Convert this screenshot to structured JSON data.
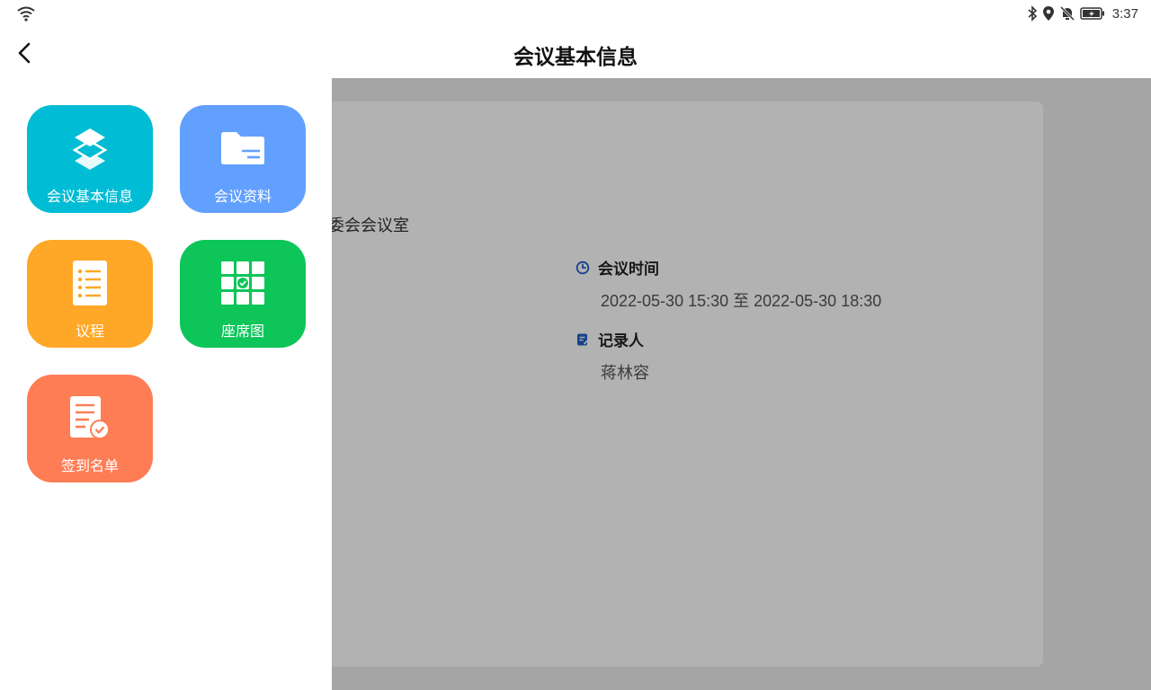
{
  "status_bar": {
    "time": "3:37",
    "icons": [
      "wifi-icon",
      "bluetooth-icon",
      "location-icon",
      "mute-icon",
      "battery-charging-icon"
    ]
  },
  "header": {
    "title": "会议基本信息",
    "back_icon": "chevron-left-icon"
  },
  "detail": {
    "location_partial": "委会会议室",
    "time_label": "会议时间",
    "time_value": "2022-05-30 15:30 至 2022-05-30 18:30",
    "recorder_label": "记录人",
    "recorder_value": "蒋林容"
  },
  "menu": {
    "items": [
      {
        "label": "会议基本信息",
        "icon": "layers-icon",
        "color": "#00BCD4"
      },
      {
        "label": "会议资料",
        "icon": "folder-icon",
        "color": "#62A0FF"
      },
      {
        "label": "议程",
        "icon": "list-document-icon",
        "color": "#FFA726"
      },
      {
        "label": "座席图",
        "icon": "seat-grid-icon",
        "color": "#0DC559"
      },
      {
        "label": "签到名单",
        "icon": "checklist-document-icon",
        "color": "#FF7D55"
      }
    ]
  },
  "colors": {
    "accent_blue": "#1E5FC8",
    "overlay": "rgba(0,0,0,0.30)"
  }
}
